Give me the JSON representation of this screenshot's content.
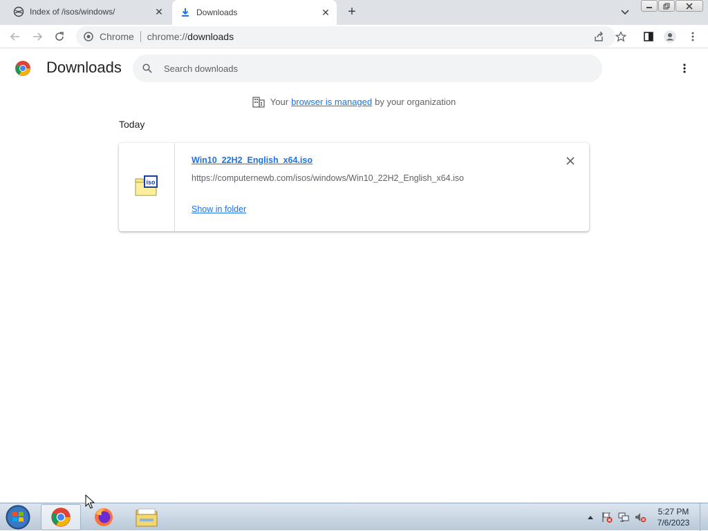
{
  "tabs": [
    {
      "title": "Index of /isos/windows/",
      "active": false,
      "icon": "web-icon"
    },
    {
      "title": "Downloads",
      "active": true,
      "icon": "download-icon"
    }
  ],
  "omnibox": {
    "chip": "Chrome",
    "url_scheme": "chrome://",
    "url_host": "downloads"
  },
  "page": {
    "title": "Downloads",
    "search_placeholder": "Search downloads"
  },
  "managed_notice": {
    "prefix": "Your",
    "link": "browser is managed",
    "suffix": "by your organization"
  },
  "section_date": "Today",
  "download": {
    "filename": "Win10_22H2_English_x64.iso",
    "url": "https://computernewb.com/isos/windows/Win10_22H2_English_x64.iso",
    "action": "Show in folder"
  },
  "clock": {
    "time": "5:27 PM",
    "date": "7/6/2023"
  },
  "colors": {
    "accent": "#1a73e8",
    "tabstrip": "#dee1e6",
    "omnibox": "#f1f3f4"
  }
}
